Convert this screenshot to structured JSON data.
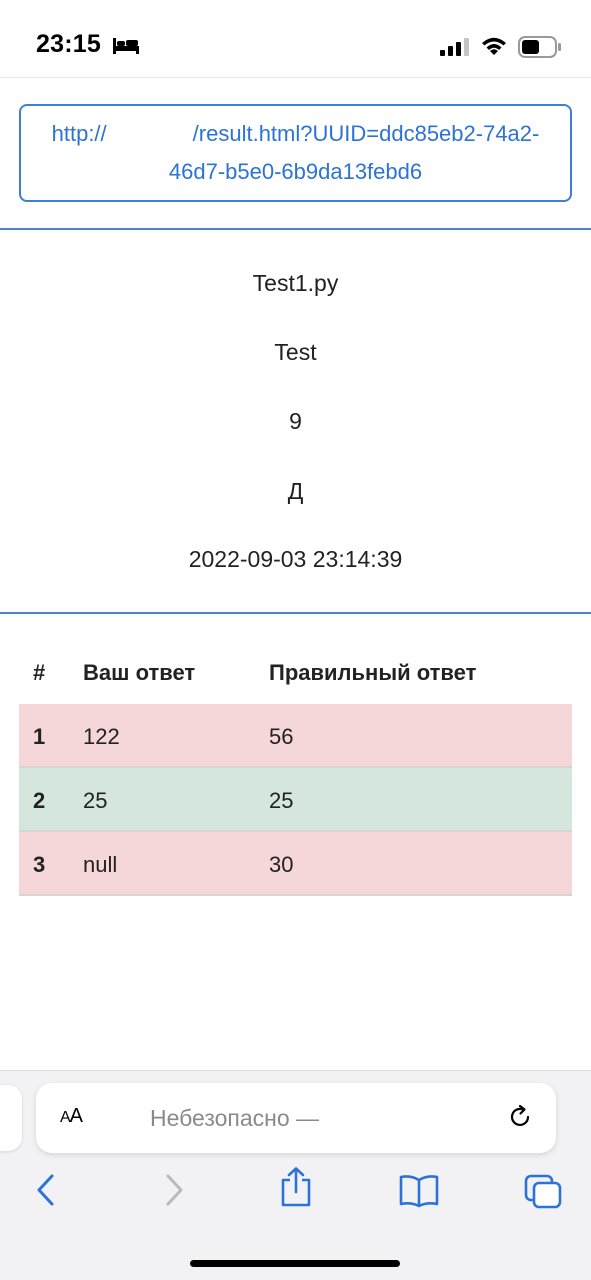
{
  "status_bar": {
    "time": "23:15"
  },
  "link": {
    "prefix": "http://",
    "suffix": "/result.html?UUID=ddc85eb2-74a2-46d7-b5e0-6b9da13febd6"
  },
  "info": {
    "file_name": "Test1.py",
    "name": "Test",
    "grade": "9",
    "letter": "Д",
    "datetime": "2022-09-03 23:14:39"
  },
  "table": {
    "headers": [
      "#",
      "Ваш ответ",
      "Правильный ответ"
    ],
    "rows": [
      {
        "num": "1",
        "yours": "122",
        "correct": "56",
        "status": "wrong"
      },
      {
        "num": "2",
        "yours": "25",
        "correct": "25",
        "status": "right"
      },
      {
        "num": "3",
        "yours": "null",
        "correct": "30",
        "status": "wrong"
      }
    ]
  },
  "browser": {
    "aa_label_small": "A",
    "aa_label_big": "A",
    "address_text": "Небезопасно —"
  },
  "colors": {
    "link": "#2d73d6",
    "wrong_row": "#f5d6d9",
    "right_row": "#d5e7dd",
    "divider": "#4b83c6"
  }
}
